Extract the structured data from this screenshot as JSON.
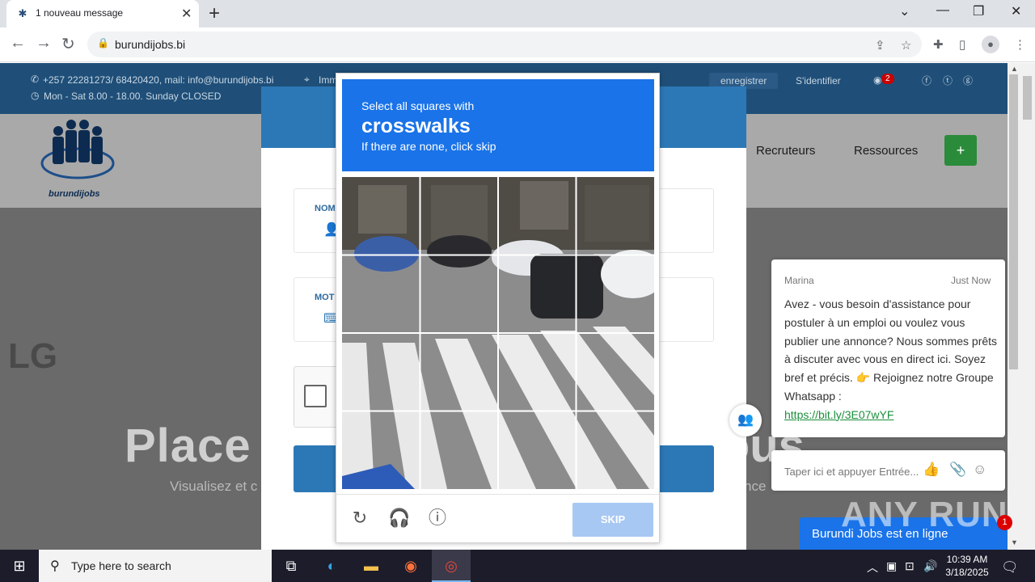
{
  "browser": {
    "tab_title": "1 nouveau message",
    "tab_close": "✕",
    "new_tab": "+",
    "url": "burundijobs.bi",
    "window_controls": {
      "collapse": "⌄",
      "minimize": "—",
      "restore": "❐",
      "close": "✕"
    }
  },
  "site": {
    "contact_line1": "+257 22281273/ 68420420, mail: info@burundijobs.bi",
    "contact_line2": "Mon - Sat 8.00 - 18.00. Sunday CLOSED",
    "address_partial": "Imm",
    "register": "enregistrer",
    "login": "S'identifier",
    "notif_count": "2",
    "logo_text": "burundijobs",
    "nav": [
      "Recruteurs",
      "Ressources"
    ],
    "plus": "+",
    "hero_title_left": "Place",
    "hero_title_right": "c nous",
    "hero_sub_left": "Visualisez et c",
    "hero_sub_right": "nce",
    "lg_logo": "LG"
  },
  "login_modal": {
    "field1_label": "NOM",
    "field2_label": "MOT"
  },
  "captcha": {
    "instruction": "Select all squares with",
    "target": "crosswalks",
    "hint": "If there are none, click skip",
    "skip_label": "SKIP"
  },
  "chat": {
    "agent": "Marina",
    "time": "Just Now",
    "message": "Avez - vous besoin d'assistance pour postuler à un emploi ou voulez vous publier une annonce? Nous sommes prêts à discuter avec vous en direct ici. Soyez bref et précis. 👉 Rejoignez notre Groupe Whatsapp :",
    "link": "https://bit.ly/3E07wYF",
    "input_placeholder": "Taper ici et appuyer Entrée...",
    "status_bar": "Burundi Jobs est en ligne",
    "badge": "1"
  },
  "watermark": "ANY RUN",
  "taskbar": {
    "search_placeholder": "Type here to search",
    "time": "10:39 AM",
    "date": "3/18/2025"
  },
  "colors": {
    "captcha_blue": "#1a73e8",
    "site_blue": "#2c78b6",
    "green": "#2a8b3a"
  }
}
